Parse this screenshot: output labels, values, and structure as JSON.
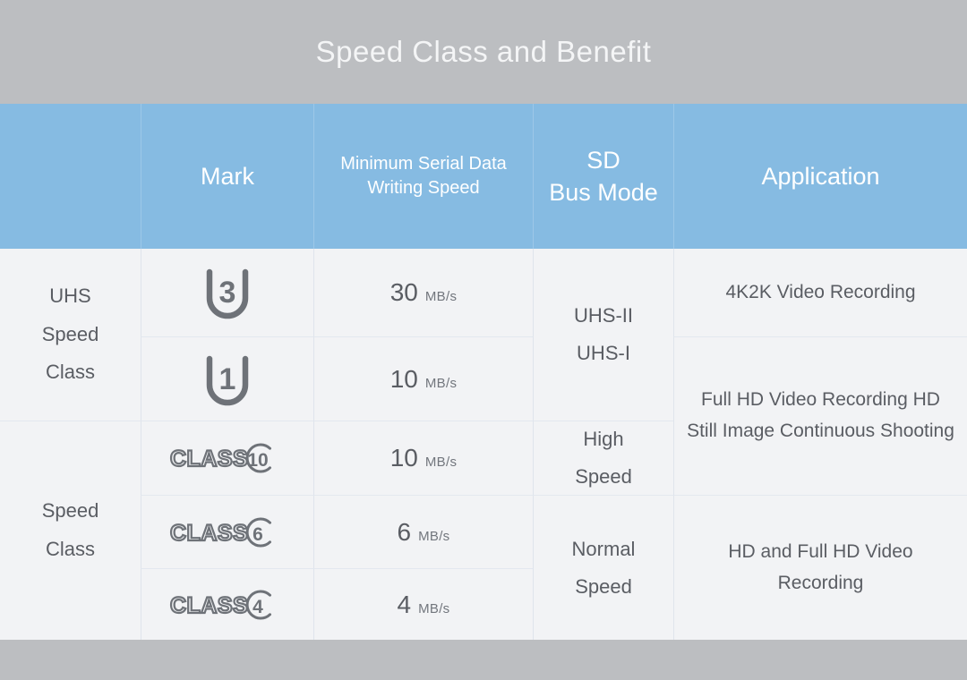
{
  "title": "Speed Class and Benefit",
  "colors": {
    "background": "#bcbec1",
    "header_blue": "#86bbe2",
    "cell_background": "#f2f3f5",
    "text": "#5a5d63",
    "header_text": "#ffffff",
    "mark_stroke": "#6e7278",
    "grid_line": "#dfe4ec"
  },
  "table": {
    "headers": [
      {
        "label": "",
        "name": "category-header"
      },
      {
        "label": "Mark",
        "name": "mark-header"
      },
      {
        "label": "Minimum Serial Data\nWriting Speed",
        "line1": "Minimum Serial Data",
        "line2": "Writing Speed",
        "name": "min-write-speed-header"
      },
      {
        "label": "SD\nBus Mode",
        "line1": "SD",
        "line2": "Bus Mode",
        "name": "sd-bus-mode-header"
      },
      {
        "label": "Application",
        "name": "application-header"
      }
    ],
    "groups": [
      {
        "label": "UHS\nSpeed\nClass",
        "line1": "UHS",
        "line2": "Speed",
        "line3": "Class",
        "rowspan": 2
      },
      {
        "label": "Speed\nClass",
        "line1": "Speed",
        "line2": "Class",
        "rowspan": 3
      }
    ],
    "rows": [
      {
        "mark_type": "uhs",
        "mark_value": "3",
        "mark_label": "U3",
        "speed_value": "30",
        "speed_unit": "MB/s"
      },
      {
        "mark_type": "uhs",
        "mark_value": "1",
        "mark_label": "U1",
        "speed_value": "10",
        "speed_unit": "MB/s"
      },
      {
        "mark_type": "class",
        "mark_prefix": "CLASS",
        "mark_value": "10",
        "mark_label": "CLASS 10",
        "speed_value": "10",
        "speed_unit": "MB/s"
      },
      {
        "mark_type": "class",
        "mark_prefix": "CLASS",
        "mark_value": "6",
        "mark_label": "CLASS 6",
        "speed_value": "6",
        "speed_unit": "MB/s"
      },
      {
        "mark_type": "class",
        "mark_prefix": "CLASS",
        "mark_value": "4",
        "mark_label": "CLASS 4",
        "speed_value": "4",
        "speed_unit": "MB/s"
      }
    ],
    "bus_modes": [
      {
        "line1": "UHS-II",
        "line2": "UHS-I",
        "covers_rows": [
          1,
          2
        ]
      },
      {
        "line1": "High",
        "line2": "Speed",
        "covers_rows": [
          3
        ]
      },
      {
        "line1": "Normal",
        "line2": "Speed",
        "covers_rows": [
          4,
          5
        ]
      }
    ],
    "applications": [
      {
        "text": "4K2K Video Recording",
        "covers_rows": [
          1
        ]
      },
      {
        "text": "Full HD Video Recording HD Still Image Continuous Shooting",
        "covers_rows": [
          2,
          3
        ]
      },
      {
        "text": "HD and Full HD Video Recording",
        "covers_rows": [
          4,
          5
        ]
      }
    ]
  }
}
